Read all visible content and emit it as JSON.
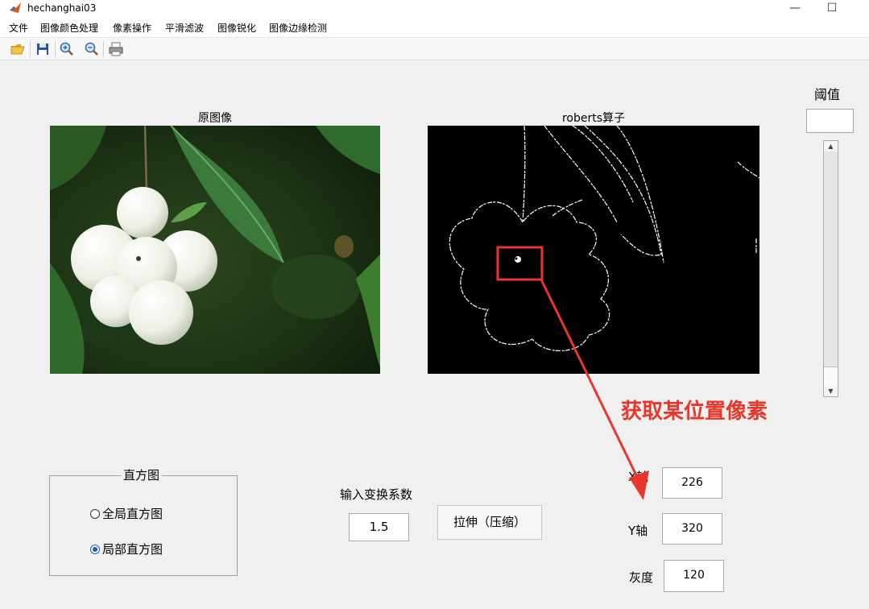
{
  "window": {
    "title": "hechanghai03"
  },
  "menu": [
    "文件",
    "图像颜色处理",
    "像素操作",
    "平滑滤波",
    "图像锐化",
    "图像边缘检测"
  ],
  "toolbar": [
    "open-icon",
    "save-icon",
    "zoom-in-icon",
    "zoom-out-icon",
    "print-icon"
  ],
  "left_axes": {
    "title": "原图像"
  },
  "right_axes": {
    "title": "roberts算子"
  },
  "threshold": {
    "label": "阈值",
    "value": ""
  },
  "annotation": {
    "text": "获取某位置像素",
    "color": "#e8372a"
  },
  "histogram": {
    "title": "直方图",
    "options": [
      {
        "label": "全局直方图",
        "checked": false
      },
      {
        "label": "局部直方图",
        "checked": true
      }
    ]
  },
  "transform": {
    "label": "输入变换系数",
    "value": "1.5",
    "button": "拉伸（压缩）"
  },
  "pixel": {
    "x_label": "X轴",
    "x_value": "226",
    "y_label": "Y轴",
    "y_value": "320",
    "gray_label": "灰度",
    "gray_value": "120"
  }
}
